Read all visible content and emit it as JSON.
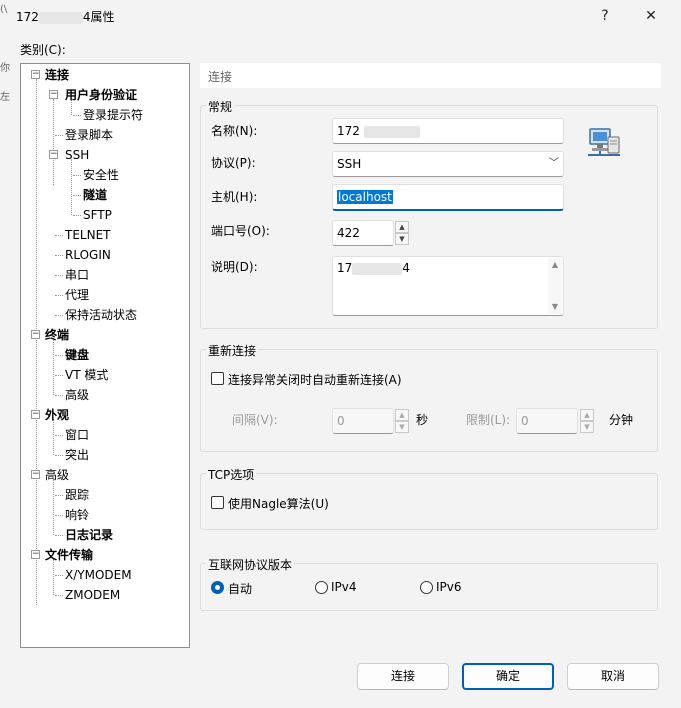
{
  "window": {
    "title_prefix": "172",
    "title_suffix": "4属性",
    "help": "?",
    "close": "✕",
    "edge_fragments": [
      "(\\",
      "你",
      "左"
    ]
  },
  "category_label": "类别(C):",
  "tree": [
    {
      "label": "连接",
      "bold": true
    },
    {
      "label": "用户身份验证",
      "bold": true
    },
    {
      "label": "登录提示符",
      "bold": false
    },
    {
      "label": "登录脚本",
      "bold": false
    },
    {
      "label": "SSH",
      "bold": false
    },
    {
      "label": "安全性",
      "bold": false
    },
    {
      "label": "隧道",
      "bold": true
    },
    {
      "label": "SFTP",
      "bold": false
    },
    {
      "label": "TELNET",
      "bold": false
    },
    {
      "label": "RLOGIN",
      "bold": false
    },
    {
      "label": "串口",
      "bold": false
    },
    {
      "label": "代理",
      "bold": false
    },
    {
      "label": "保持活动状态",
      "bold": false
    },
    {
      "label": "终端",
      "bold": true
    },
    {
      "label": "键盘",
      "bold": true
    },
    {
      "label": "VT 模式",
      "bold": false
    },
    {
      "label": "高级",
      "bold": false
    },
    {
      "label": "外观",
      "bold": true
    },
    {
      "label": "窗口",
      "bold": false
    },
    {
      "label": "突出",
      "bold": false
    },
    {
      "label": "高级",
      "bold": false
    },
    {
      "label": "跟踪",
      "bold": false
    },
    {
      "label": "响铃",
      "bold": false
    },
    {
      "label": "日志记录",
      "bold": true
    },
    {
      "label": "文件传输",
      "bold": true
    },
    {
      "label": "X/YMODEM",
      "bold": false
    },
    {
      "label": "ZMODEM",
      "bold": false
    }
  ],
  "panel_header": "连接",
  "general": {
    "title": "常规",
    "name_label": "名称(N):",
    "name_value": "172",
    "protocol_label": "协议(P):",
    "protocol_value": "SSH",
    "host_label": "主机(H):",
    "host_value": "localhost",
    "port_label": "端口号(O):",
    "port_value": "422",
    "desc_label": "说明(D):",
    "desc_prefix": "17",
    "desc_suffix": "4"
  },
  "reconnect": {
    "title": "重新连接",
    "checkbox_label": "连接异常关闭时自动重新连接(A)",
    "interval_label": "间隔(V):",
    "interval_value": "0",
    "interval_unit": "秒",
    "limit_label": "限制(L):",
    "limit_value": "0",
    "limit_unit": "分钟"
  },
  "tcp": {
    "title": "TCP选项",
    "nagle_label": "使用Nagle算法(U)"
  },
  "ipver": {
    "title": "互联网协议版本",
    "options": [
      "自动",
      "IPv4",
      "IPv6"
    ],
    "selected": "自动"
  },
  "buttons": {
    "connect": "连接",
    "ok": "确定",
    "cancel": "取消"
  },
  "colors": {
    "accent": "#005fb8",
    "selection": "#0078d7"
  }
}
